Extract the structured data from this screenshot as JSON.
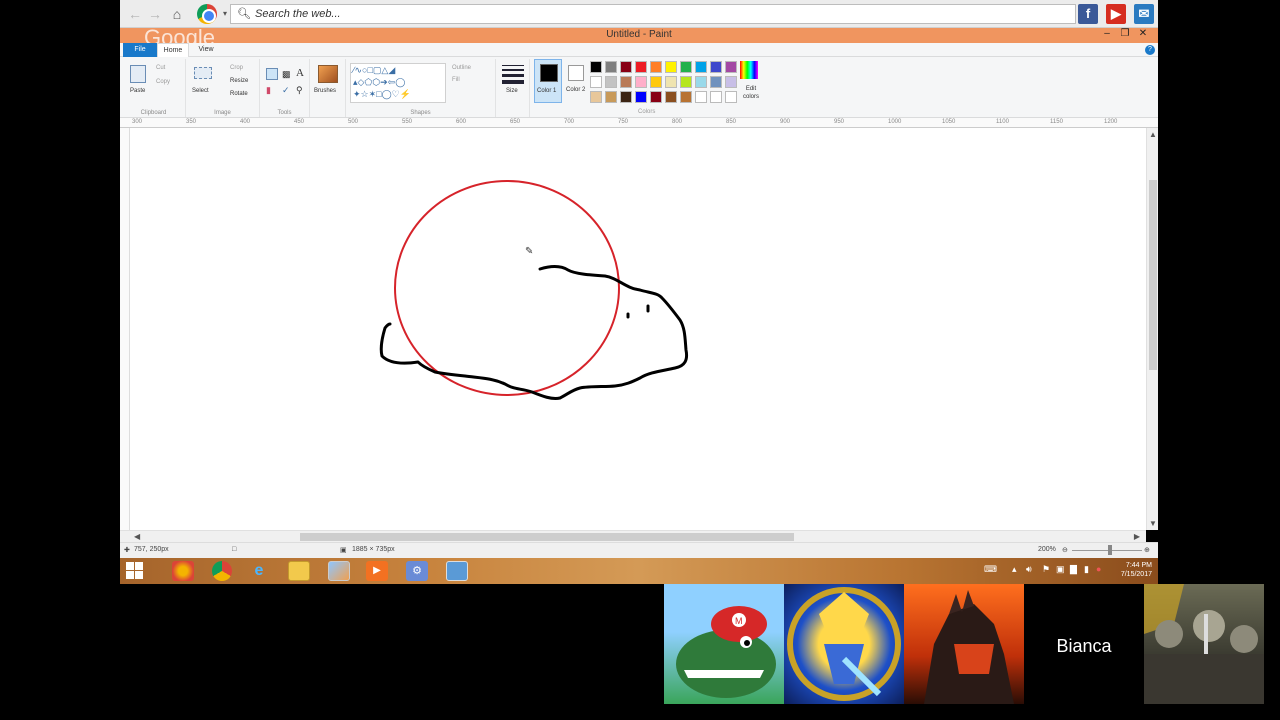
{
  "browser": {
    "search_placeholder": "Search the web...",
    "search_icon": "magnifier-icon",
    "buttons": [
      "back",
      "forward",
      "home",
      "chrome"
    ],
    "social": [
      "f",
      "▶",
      "✉"
    ]
  },
  "paint": {
    "title": "Untitled - Paint",
    "watermark": "Google",
    "tabs": [
      "File",
      "Home",
      "View"
    ],
    "ribbon": {
      "clipboard": {
        "label": "Clipboard",
        "paste": "Paste",
        "cut": "Cut",
        "copy": "Copy"
      },
      "image": {
        "label": "Image",
        "select": "Select",
        "crop": "Crop",
        "resize": "Resize",
        "rotate": "Rotate"
      },
      "tools": {
        "label": "Tools"
      },
      "brushes": {
        "label": "Brushes"
      },
      "shapes": {
        "label": "Shapes",
        "outline": "Outline",
        "fill": "Fill"
      },
      "size": {
        "label": "Size"
      },
      "color1": {
        "label": "Color 1"
      },
      "color2": {
        "label": "Color 2"
      },
      "colors": {
        "label": "Colors"
      },
      "edit_colors": {
        "label": "Edit colors"
      }
    },
    "palette_row1": [
      "#000000",
      "#7f7f7f",
      "#880015",
      "#ed1c24",
      "#ff7f27",
      "#fff200",
      "#22b14c",
      "#00a2e8",
      "#3f48cc",
      "#a349a4"
    ],
    "palette_row2": [
      "#ffffff",
      "#c3c3c3",
      "#b97a57",
      "#ffaec9",
      "#ffc90e",
      "#efe4b0",
      "#b5e61d",
      "#99d9ea",
      "#7092be",
      "#c8bfe7"
    ],
    "palette_row3": [
      "#e8c79a",
      "#c89a5a",
      "#3c2414",
      "#0000ff",
      "#880015",
      "#8a4f1f",
      "#b87333",
      "#ffffff",
      "#ffffff",
      "#ffffff"
    ],
    "ruler_ticks": [
      "300",
      "350",
      "400",
      "450",
      "500",
      "550",
      "600",
      "650",
      "700",
      "750",
      "800",
      "850",
      "900",
      "950",
      "1000",
      "1050",
      "1100",
      "1150",
      "1200"
    ],
    "status": {
      "cursor_pos": "757, 250px",
      "canvas_size": "1885 × 735px",
      "zoom": "200%"
    },
    "drawing": {
      "circle_color": "#d6232a",
      "stroke_color": "#000000"
    }
  },
  "taskbar": {
    "time": "7:44 PM",
    "date": "7/15/2017",
    "apps": [
      "chrome-beta",
      "chrome",
      "internet-explorer",
      "file-explorer",
      "paint",
      "media",
      "tool",
      "display"
    ]
  },
  "participants": [
    {
      "id": "gator"
    },
    {
      "id": "dragon"
    },
    {
      "id": "godzilla"
    },
    {
      "id": "bianca",
      "name": "Bianca"
    },
    {
      "id": "soldiers"
    }
  ]
}
